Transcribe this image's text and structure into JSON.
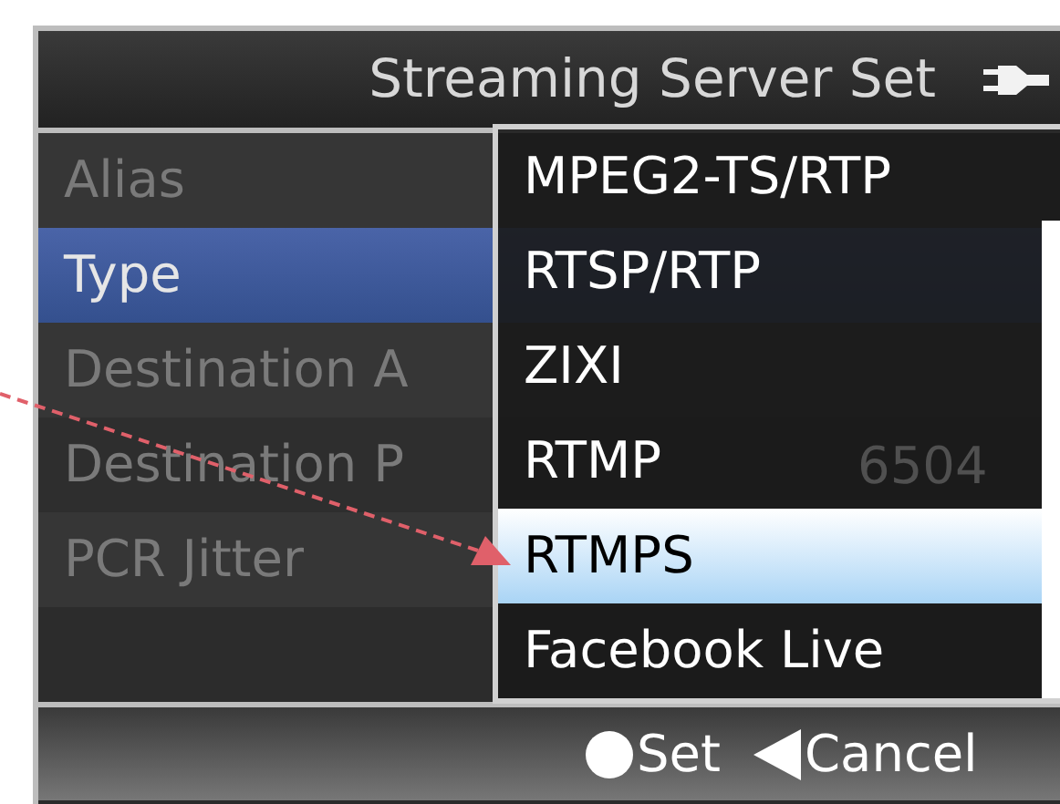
{
  "window": {
    "title": "Streaming Server Set"
  },
  "rows": [
    {
      "label": "Alias",
      "selected": false
    },
    {
      "label": "Type",
      "selected": true
    },
    {
      "label": "Destination A",
      "selected": false
    },
    {
      "label": "Destination P",
      "selected": false
    },
    {
      "label": "PCR Jitter",
      "selected": false
    }
  ],
  "values": [
    {
      "text": "6504"
    }
  ],
  "dropdown": {
    "items": [
      {
        "label": "MPEG2-TS/RTP",
        "selected": false
      },
      {
        "label": "RTSP/RTP",
        "selected": false
      },
      {
        "label": "ZIXI",
        "selected": false
      },
      {
        "label": "RTMP",
        "selected": false
      },
      {
        "label": "RTMPS",
        "selected": true
      },
      {
        "label": "Facebook Live",
        "selected": false
      }
    ]
  },
  "footer": {
    "buttons": [
      {
        "kind": "set",
        "label": "Set"
      },
      {
        "kind": "cancel",
        "label": "Cancel"
      }
    ]
  }
}
